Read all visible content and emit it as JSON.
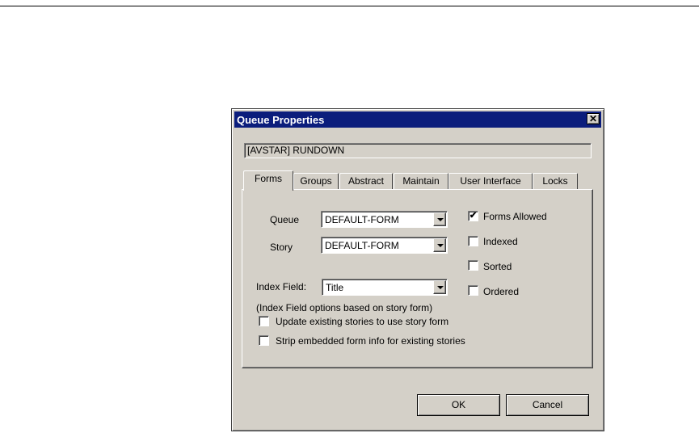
{
  "dialog": {
    "title": "Queue Properties",
    "close_glyph": "✕",
    "path": "[AVSTAR] RUNDOWN"
  },
  "tabs": [
    {
      "label": "Forms",
      "active": true
    },
    {
      "label": "Groups",
      "active": false
    },
    {
      "label": "Abstract",
      "active": false
    },
    {
      "label": "Maintain",
      "active": false
    },
    {
      "label": "User Interface",
      "active": false
    },
    {
      "label": "Locks",
      "active": false
    }
  ],
  "forms": {
    "queue_label": "Queue",
    "queue_value": "DEFAULT-FORM",
    "story_label": "Story",
    "story_value": "DEFAULT-FORM",
    "index_field_label": "Index Field:",
    "index_field_value": "Title",
    "index_note": "(Index Field options based on story form)",
    "update_existing": {
      "label": "Update existing stories to use story form",
      "checked": false
    },
    "strip_embedded": {
      "label": "Strip embedded form info for existing stories",
      "checked": false
    },
    "forms_allowed": {
      "label": "Forms Allowed",
      "checked": true
    },
    "indexed": {
      "label": "Indexed",
      "checked": false
    },
    "sorted": {
      "label": "Sorted",
      "checked": false
    },
    "ordered": {
      "label": "Ordered",
      "checked": false
    },
    "check_glyph": "✔"
  },
  "buttons": {
    "ok": "OK",
    "cancel": "Cancel"
  },
  "colors": {
    "titlebar": "#0b1d7c",
    "face": "#d4d0c8"
  },
  "icons": [
    "close-icon",
    "dropdown-arrow-icon",
    "checkmark-icon"
  ]
}
